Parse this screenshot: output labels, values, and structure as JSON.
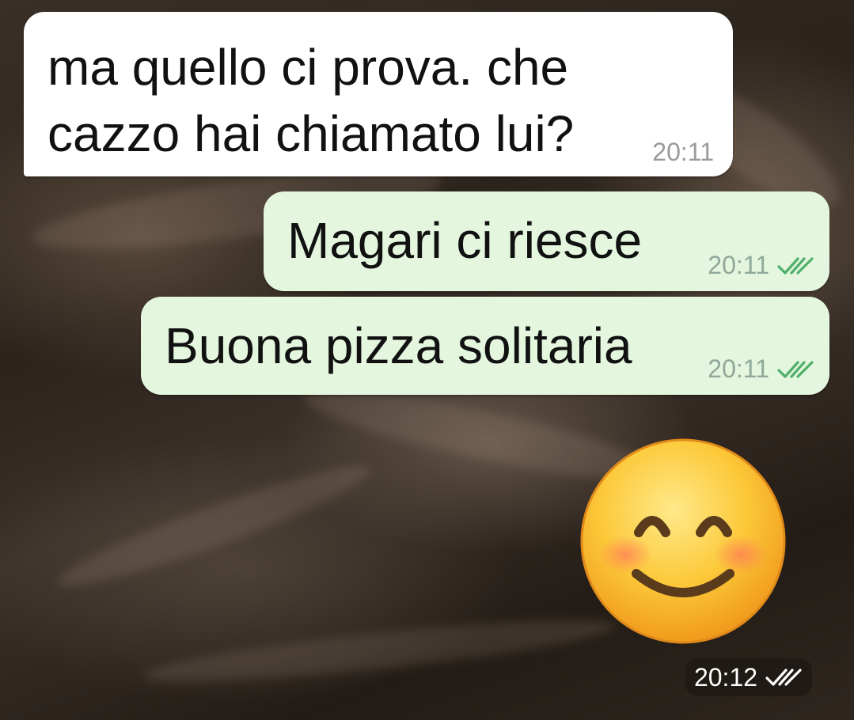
{
  "messages": [
    {
      "direction": "incoming",
      "text": "ma quello ci prova. che cazzo hai chiamato lui?",
      "time": "20:11"
    },
    {
      "direction": "outgoing",
      "text": "Magari ci riesce",
      "time": "20:11",
      "status": "read-double-check-icon"
    },
    {
      "direction": "outgoing",
      "text": "Buona pizza solitaria",
      "time": "20:11",
      "status": "read-double-check-icon"
    },
    {
      "direction": "outgoing",
      "content": "smiling-face-with-smiling-eyes-emoji",
      "time": "20:12",
      "status": "read-double-check-icon"
    }
  ],
  "colors": {
    "incoming_bubble": "#ffffff",
    "outgoing_bubble": "#e4f6de",
    "read_ticks": "#4fb06b"
  }
}
